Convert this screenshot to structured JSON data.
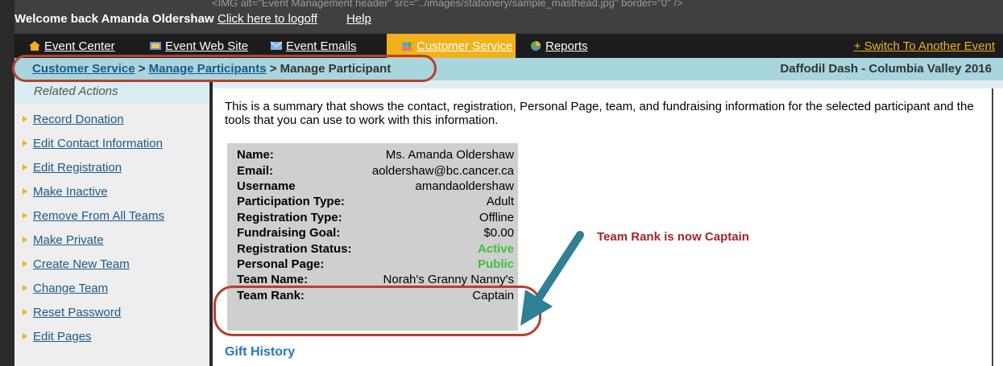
{
  "welcome": {
    "ghost_text": "<IMG alt=\"Event Management header\" src=\"../images/stationery/sample_masthead.jpg\" border=\"0\" />",
    "greeting": "Welcome back Amanda Oldershaw",
    "logoff": "Click here to logoff",
    "help": "Help"
  },
  "nav": {
    "items": [
      {
        "label": "Event Center",
        "icon": "home-icon"
      },
      {
        "label": "Event Web Site",
        "icon": "website-icon"
      },
      {
        "label": "Event Emails",
        "icon": "envelope-icon"
      },
      {
        "label": "Customer Service",
        "icon": "users-icon",
        "active": true
      },
      {
        "label": "Reports",
        "icon": "pie-chart-icon"
      }
    ],
    "switch": "+ Switch To Another Event"
  },
  "breadcrumb": {
    "items": [
      "Customer Service",
      "Manage Participants",
      "Manage Participant"
    ],
    "separator": ">",
    "event_name": "Daffodil Dash - Columbia Valley 2016"
  },
  "sidebar": {
    "heading": "Related Actions",
    "items": [
      "Record Donation",
      "Edit Contact Information",
      "Edit Registration",
      "Make Inactive",
      "Remove From All Teams",
      "Make Private",
      "Create New Team",
      "Change Team",
      "Reset Password",
      "Edit Pages"
    ]
  },
  "main": {
    "summary": "This is a summary that shows the contact, registration, Personal Page, team, and fundraising information for the selected participant and the tools that you can use to work with this information.",
    "fields": [
      {
        "label": "Name:",
        "value": "Ms. Amanda Oldershaw"
      },
      {
        "label": "Email:",
        "value": "aoldershaw@bc.cancer.ca"
      },
      {
        "label": "Username",
        "value": "amandaoldershaw"
      },
      {
        "label": "Participation Type:",
        "value": "Adult"
      },
      {
        "label": "Registration Type:",
        "value": "Offline"
      },
      {
        "label": "Fundraising Goal:",
        "value": "$0.00"
      },
      {
        "label": "Registration Status:",
        "value": "Active",
        "status": true
      },
      {
        "label": "Personal Page:",
        "value": "Public",
        "status": true
      },
      {
        "label": "Team Name:",
        "value": "Norah's Granny Nanny's"
      },
      {
        "label": "Team Rank:",
        "value": "Captain"
      }
    ],
    "gift_history": "Gift History"
  },
  "annotation": {
    "text": "Team Rank is now Captain"
  },
  "colors": {
    "accent": "#f2b11b",
    "annotation": "#b7412f",
    "arrow": "#2f7f95",
    "status_green": "#3cc23c",
    "link": "#1a5a8a"
  }
}
